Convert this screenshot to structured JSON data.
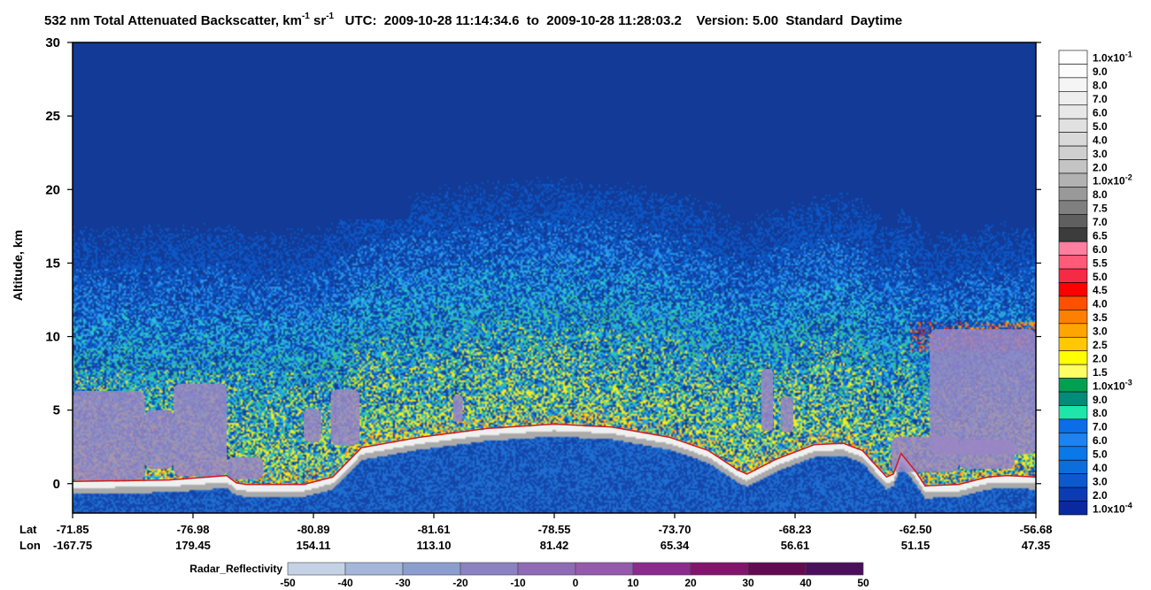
{
  "title": {
    "main": "532 nm Total Attenuated Backscatter, km",
    "sup1": "-1",
    "sr": " sr",
    "sup2": "-1",
    "utc": "UTC:  2009-10-28 11:14:34.6  to  2009-10-28 11:28:03.2",
    "version": "Version: 5.00  Standard  Daytime"
  },
  "chart_data": {
    "type": "heatmap",
    "ylabel": "Altitude, km",
    "ylim": [
      -2,
      30
    ],
    "yticks": [
      "0",
      "5",
      "10",
      "15",
      "20",
      "25",
      "30"
    ],
    "yticks_values": [
      0,
      5,
      10,
      15,
      20,
      25,
      30
    ],
    "geo_labels": {
      "lat": "Lat",
      "lon": "Lon"
    },
    "geo_ticks": [
      {
        "lat": "-71.85",
        "lon": "-167.75"
      },
      {
        "lat": "-76.98",
        "lon": "179.45"
      },
      {
        "lat": "-80.89",
        "lon": "154.11"
      },
      {
        "lat": "-81.61",
        "lon": "113.10"
      },
      {
        "lat": "-78.55",
        "lon": "81.42"
      },
      {
        "lat": "-73.70",
        "lon": "65.34"
      },
      {
        "lat": "-68.23",
        "lon": "56.61"
      },
      {
        "lat": "-62.50",
        "lon": "51.15"
      },
      {
        "lat": "-56.68",
        "lon": "47.35"
      }
    ],
    "surface_profile": [
      [
        0.0,
        -0.1
      ],
      [
        0.1,
        0.0
      ],
      [
        0.16,
        0.3
      ],
      [
        0.17,
        -0.2
      ],
      [
        0.18,
        -0.3
      ],
      [
        0.24,
        -0.3
      ],
      [
        0.27,
        0.2
      ],
      [
        0.3,
        2.2
      ],
      [
        0.36,
        2.9
      ],
      [
        0.43,
        3.5
      ],
      [
        0.5,
        3.8
      ],
      [
        0.56,
        3.6
      ],
      [
        0.62,
        2.9
      ],
      [
        0.66,
        2.0
      ],
      [
        0.69,
        0.7
      ],
      [
        0.7,
        0.4
      ],
      [
        0.73,
        1.4
      ],
      [
        0.77,
        2.4
      ],
      [
        0.8,
        2.5
      ],
      [
        0.82,
        2.0
      ],
      [
        0.845,
        0.2
      ],
      [
        0.852,
        0.4
      ],
      [
        0.86,
        1.8
      ],
      [
        0.875,
        0.6
      ],
      [
        0.885,
        -0.4
      ],
      [
        0.92,
        -0.3
      ],
      [
        0.95,
        0.2
      ],
      [
        0.97,
        0.3
      ],
      [
        1.0,
        0.2
      ]
    ],
    "radar_columns": [
      {
        "x0": 0.0,
        "x1": 0.075,
        "bottom": 0.2,
        "top": 6.3
      },
      {
        "x0": 0.075,
        "x1": 0.105,
        "bottom": 1.0,
        "top": 5.0
      },
      {
        "x0": 0.105,
        "x1": 0.16,
        "bottom": 0.5,
        "top": 6.8
      },
      {
        "x0": 0.16,
        "x1": 0.198,
        "bottom": 0.3,
        "top": 1.8
      },
      {
        "x0": 0.24,
        "x1": 0.258,
        "bottom": 2.8,
        "top": 5.1
      },
      {
        "x0": 0.268,
        "x1": 0.298,
        "bottom": 2.6,
        "top": 6.4
      },
      {
        "x0": 0.395,
        "x1": 0.405,
        "bottom": 4.2,
        "top": 6.0
      },
      {
        "x0": 0.715,
        "x1": 0.727,
        "bottom": 3.6,
        "top": 7.8
      },
      {
        "x0": 0.735,
        "x1": 0.748,
        "bottom": 3.5,
        "top": 5.9
      },
      {
        "x0": 0.85,
        "x1": 0.92,
        "bottom": 0.8,
        "top": 3.2
      },
      {
        "x0": 0.92,
        "x1": 0.978,
        "bottom": 1.0,
        "top": 3.0
      },
      {
        "x0": 0.89,
        "x1": 1.0,
        "bottom": 2.0,
        "top": 10.5
      }
    ],
    "colorbar": [
      {
        "label": "1.0x10",
        "sup": "-1",
        "color": "#ffffff"
      },
      {
        "label": "9.0",
        "color": "#fcfcfc"
      },
      {
        "label": "8.0",
        "color": "#f5f5f5"
      },
      {
        "label": "7.0",
        "color": "#eeeeee"
      },
      {
        "label": "6.0",
        "color": "#e8e8e8"
      },
      {
        "label": "5.0",
        "color": "#e1e1e1"
      },
      {
        "label": "4.0",
        "color": "#d9d9d9"
      },
      {
        "label": "3.0",
        "color": "#cfcfcf"
      },
      {
        "label": "2.0",
        "color": "#c4c4c4"
      },
      {
        "label": "1.0x10",
        "sup": "-2",
        "color": "#b2b2b2"
      },
      {
        "label": "8.0",
        "color": "#999999"
      },
      {
        "label": "7.5",
        "color": "#7f7f7f"
      },
      {
        "label": "7.0",
        "color": "#5f5f5f"
      },
      {
        "label": "6.5",
        "color": "#3c3c3c"
      },
      {
        "label": "6.0",
        "color": "#ff7fa0"
      },
      {
        "label": "5.5",
        "color": "#ff5a78"
      },
      {
        "label": "5.0",
        "color": "#f52a44"
      },
      {
        "label": "4.5",
        "color": "#ff0000"
      },
      {
        "label": "4.0",
        "color": "#ff5000"
      },
      {
        "label": "3.5",
        "color": "#ff8000"
      },
      {
        "label": "3.0",
        "color": "#ffa500"
      },
      {
        "label": "2.5",
        "color": "#ffc800"
      },
      {
        "label": "2.0",
        "color": "#ffff00"
      },
      {
        "label": "1.5",
        "color": "#ffff64"
      },
      {
        "label": "1.0x10",
        "sup": "-3",
        "color": "#00a050"
      },
      {
        "label": "9.0",
        "color": "#008c78"
      },
      {
        "label": "8.0",
        "color": "#1ee6aa"
      },
      {
        "label": "7.0",
        "color": "#0a6ee6"
      },
      {
        "label": "6.0",
        "color": "#1e82f0"
      },
      {
        "label": "5.0",
        "color": "#0a78e6"
      },
      {
        "label": "4.0",
        "color": "#0a6edc"
      },
      {
        "label": "3.0",
        "color": "#0a5acd"
      },
      {
        "label": "2.0",
        "color": "#0a3cb4"
      },
      {
        "label": "1.0x10",
        "sup": "-4",
        "color": "#0a28a0"
      }
    ],
    "radar_bar": {
      "label": "Radar_Reflectivity",
      "ticks": [
        "-50",
        "-40",
        "-30",
        "-20",
        "-10",
        "0",
        "10",
        "20",
        "30",
        "40",
        "50"
      ],
      "colors": [
        "#c5d2e6",
        "#a4b6da",
        "#8c9dd0",
        "#8a82c2",
        "#8f6ab6",
        "#955aad",
        "#8c2a8e",
        "#82146e",
        "#640a50",
        "#4b0f5e"
      ]
    }
  }
}
